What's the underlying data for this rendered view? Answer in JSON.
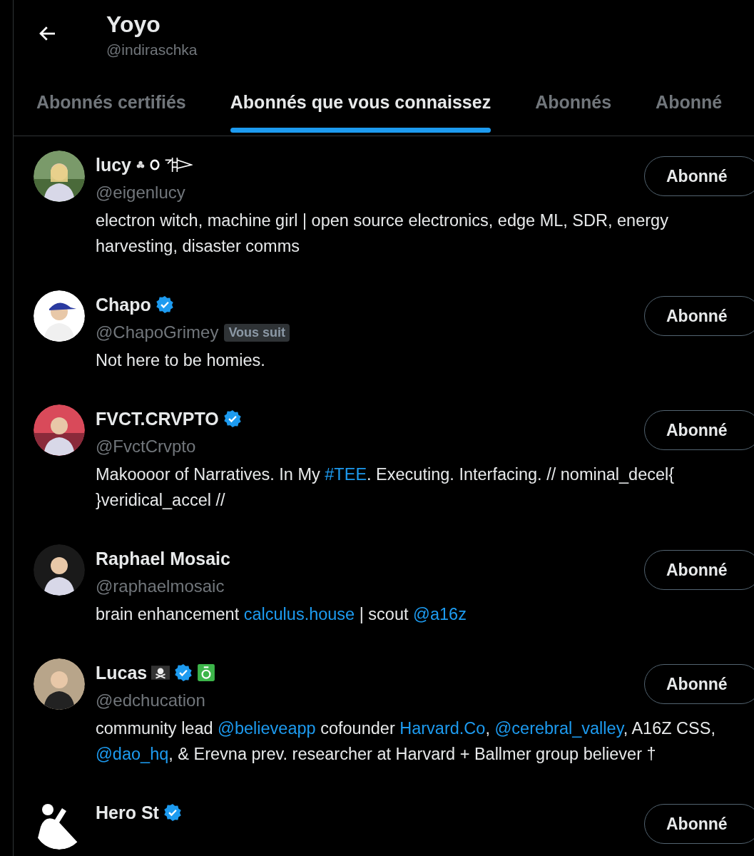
{
  "header": {
    "title": "Yoyo",
    "handle": "@indiraschka"
  },
  "tabs": [
    {
      "label": "Abonnés certifiés",
      "selected": false
    },
    {
      "label": "Abonnés que vous connaissez",
      "selected": true
    },
    {
      "label": "Abonnés",
      "selected": false
    },
    {
      "label": "Abonné",
      "selected": false
    }
  ],
  "users": [
    {
      "name": "lucy",
      "emblems": [
        {
          "kind": "flower"
        },
        {
          "kind": "ring"
        },
        {
          "kind": "glyph"
        }
      ],
      "handle": "@eigenlucy",
      "button": "Abonné",
      "bio": [
        {
          "text": "electron witch, machine girl | open source electronics, edge ML, SDR, energy harvesting, disaster comms",
          "link": false
        }
      ]
    },
    {
      "name": "Chapo",
      "emblems": [
        {
          "kind": "verified"
        }
      ],
      "handle": "@ChapoGrimey",
      "follows_badge": "Vous suit",
      "button": "Abonné",
      "bio": [
        {
          "text": "Not here to be homies.",
          "link": false
        }
      ]
    },
    {
      "name": "FVCT.CRVPTO",
      "emblems": [
        {
          "kind": "verified"
        }
      ],
      "handle": "@FvctCrvpto",
      "button": "Abonné",
      "bio": [
        {
          "text": "Makoooor of Narratives. In My ",
          "link": false
        },
        {
          "text": "#TEE",
          "link": true
        },
        {
          "text": ". Executing. Interfacing. // nominal_decel{ }veridical_accel //",
          "link": false
        }
      ]
    },
    {
      "name": "Raphael Mosaic",
      "handle": "@raphaelmosaic",
      "button": "Abonné",
      "bio": [
        {
          "text": "brain enhancement ",
          "link": false
        },
        {
          "text": "calculus.house",
          "link": true
        },
        {
          "text": " | scout ",
          "link": false
        },
        {
          "text": "@a16z",
          "link": true
        }
      ]
    },
    {
      "name": "Lucas",
      "emblems": [
        {
          "kind": "skull"
        },
        {
          "kind": "verified"
        },
        {
          "kind": "green"
        }
      ],
      "handle": "@edchucation",
      "button": "Abonné",
      "bio": [
        {
          "text": "community lead ",
          "link": false
        },
        {
          "text": "@believeapp",
          "link": true
        },
        {
          "text": " cofounder ",
          "link": false
        },
        {
          "text": "Harvard.Co",
          "link": true
        },
        {
          "text": ", ",
          "link": false
        },
        {
          "text": "@cerebral_valley",
          "link": true
        },
        {
          "text": ", A16Z CSS, ",
          "link": false
        },
        {
          "text": "@dao_hq",
          "link": true
        },
        {
          "text": ", & Erevna prev. researcher at Harvard + Ballmer group believer †",
          "link": false
        }
      ]
    },
    {
      "name": "Hero St",
      "emblems": [
        {
          "kind": "verified"
        }
      ],
      "button": "Abonné"
    }
  ]
}
